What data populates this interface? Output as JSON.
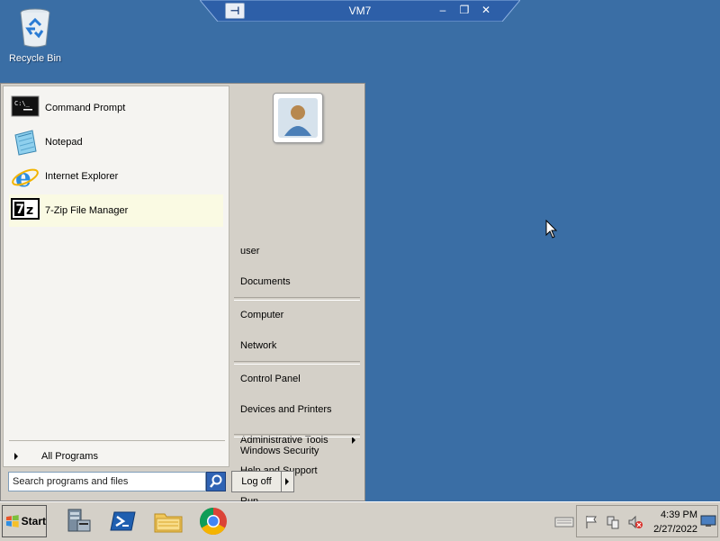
{
  "desktop": {
    "icons": [
      {
        "label": "Recycle Bin",
        "icon": "recycle-bin-icon"
      }
    ]
  },
  "vm_bar": {
    "title": "VM7",
    "pin_label": "⊣",
    "controls": [
      "minimize-icon",
      "restore-icon",
      "close-icon"
    ]
  },
  "start_menu": {
    "programs": [
      {
        "label": "Command Prompt",
        "icon": "command-prompt-icon"
      },
      {
        "label": "Notepad",
        "icon": "notepad-icon"
      },
      {
        "label": "Internet Explorer",
        "icon": "internet-explorer-icon"
      },
      {
        "label": "7-Zip File Manager",
        "icon": "7zip-icon",
        "highlighted": true
      }
    ],
    "all_programs": "All Programs",
    "search": {
      "placeholder": "Search programs and files"
    },
    "right_items": [
      {
        "label": "user"
      },
      {
        "label": "Documents"
      },
      {
        "label": "Computer"
      },
      {
        "label": "Network"
      },
      {
        "label": "Control Panel"
      },
      {
        "label": "Devices and Printers"
      },
      {
        "label": "Administrative Tools",
        "submenu": true
      },
      {
        "label": "Help and Support"
      },
      {
        "label": "Run..."
      },
      {
        "label": "Windows Security"
      }
    ],
    "logoff": "Log off"
  },
  "taskbar": {
    "start_label": "Start",
    "pinned": [
      "server-manager-icon",
      "powershell-icon",
      "file-explorer-icon",
      "chrome-icon"
    ],
    "clock": {
      "time": "4:39 PM",
      "date": "2/27/2022"
    }
  },
  "colors": {
    "desktop": "#3a6ea5",
    "menu": "#d4d0c8",
    "highlight": "#fafae3"
  }
}
